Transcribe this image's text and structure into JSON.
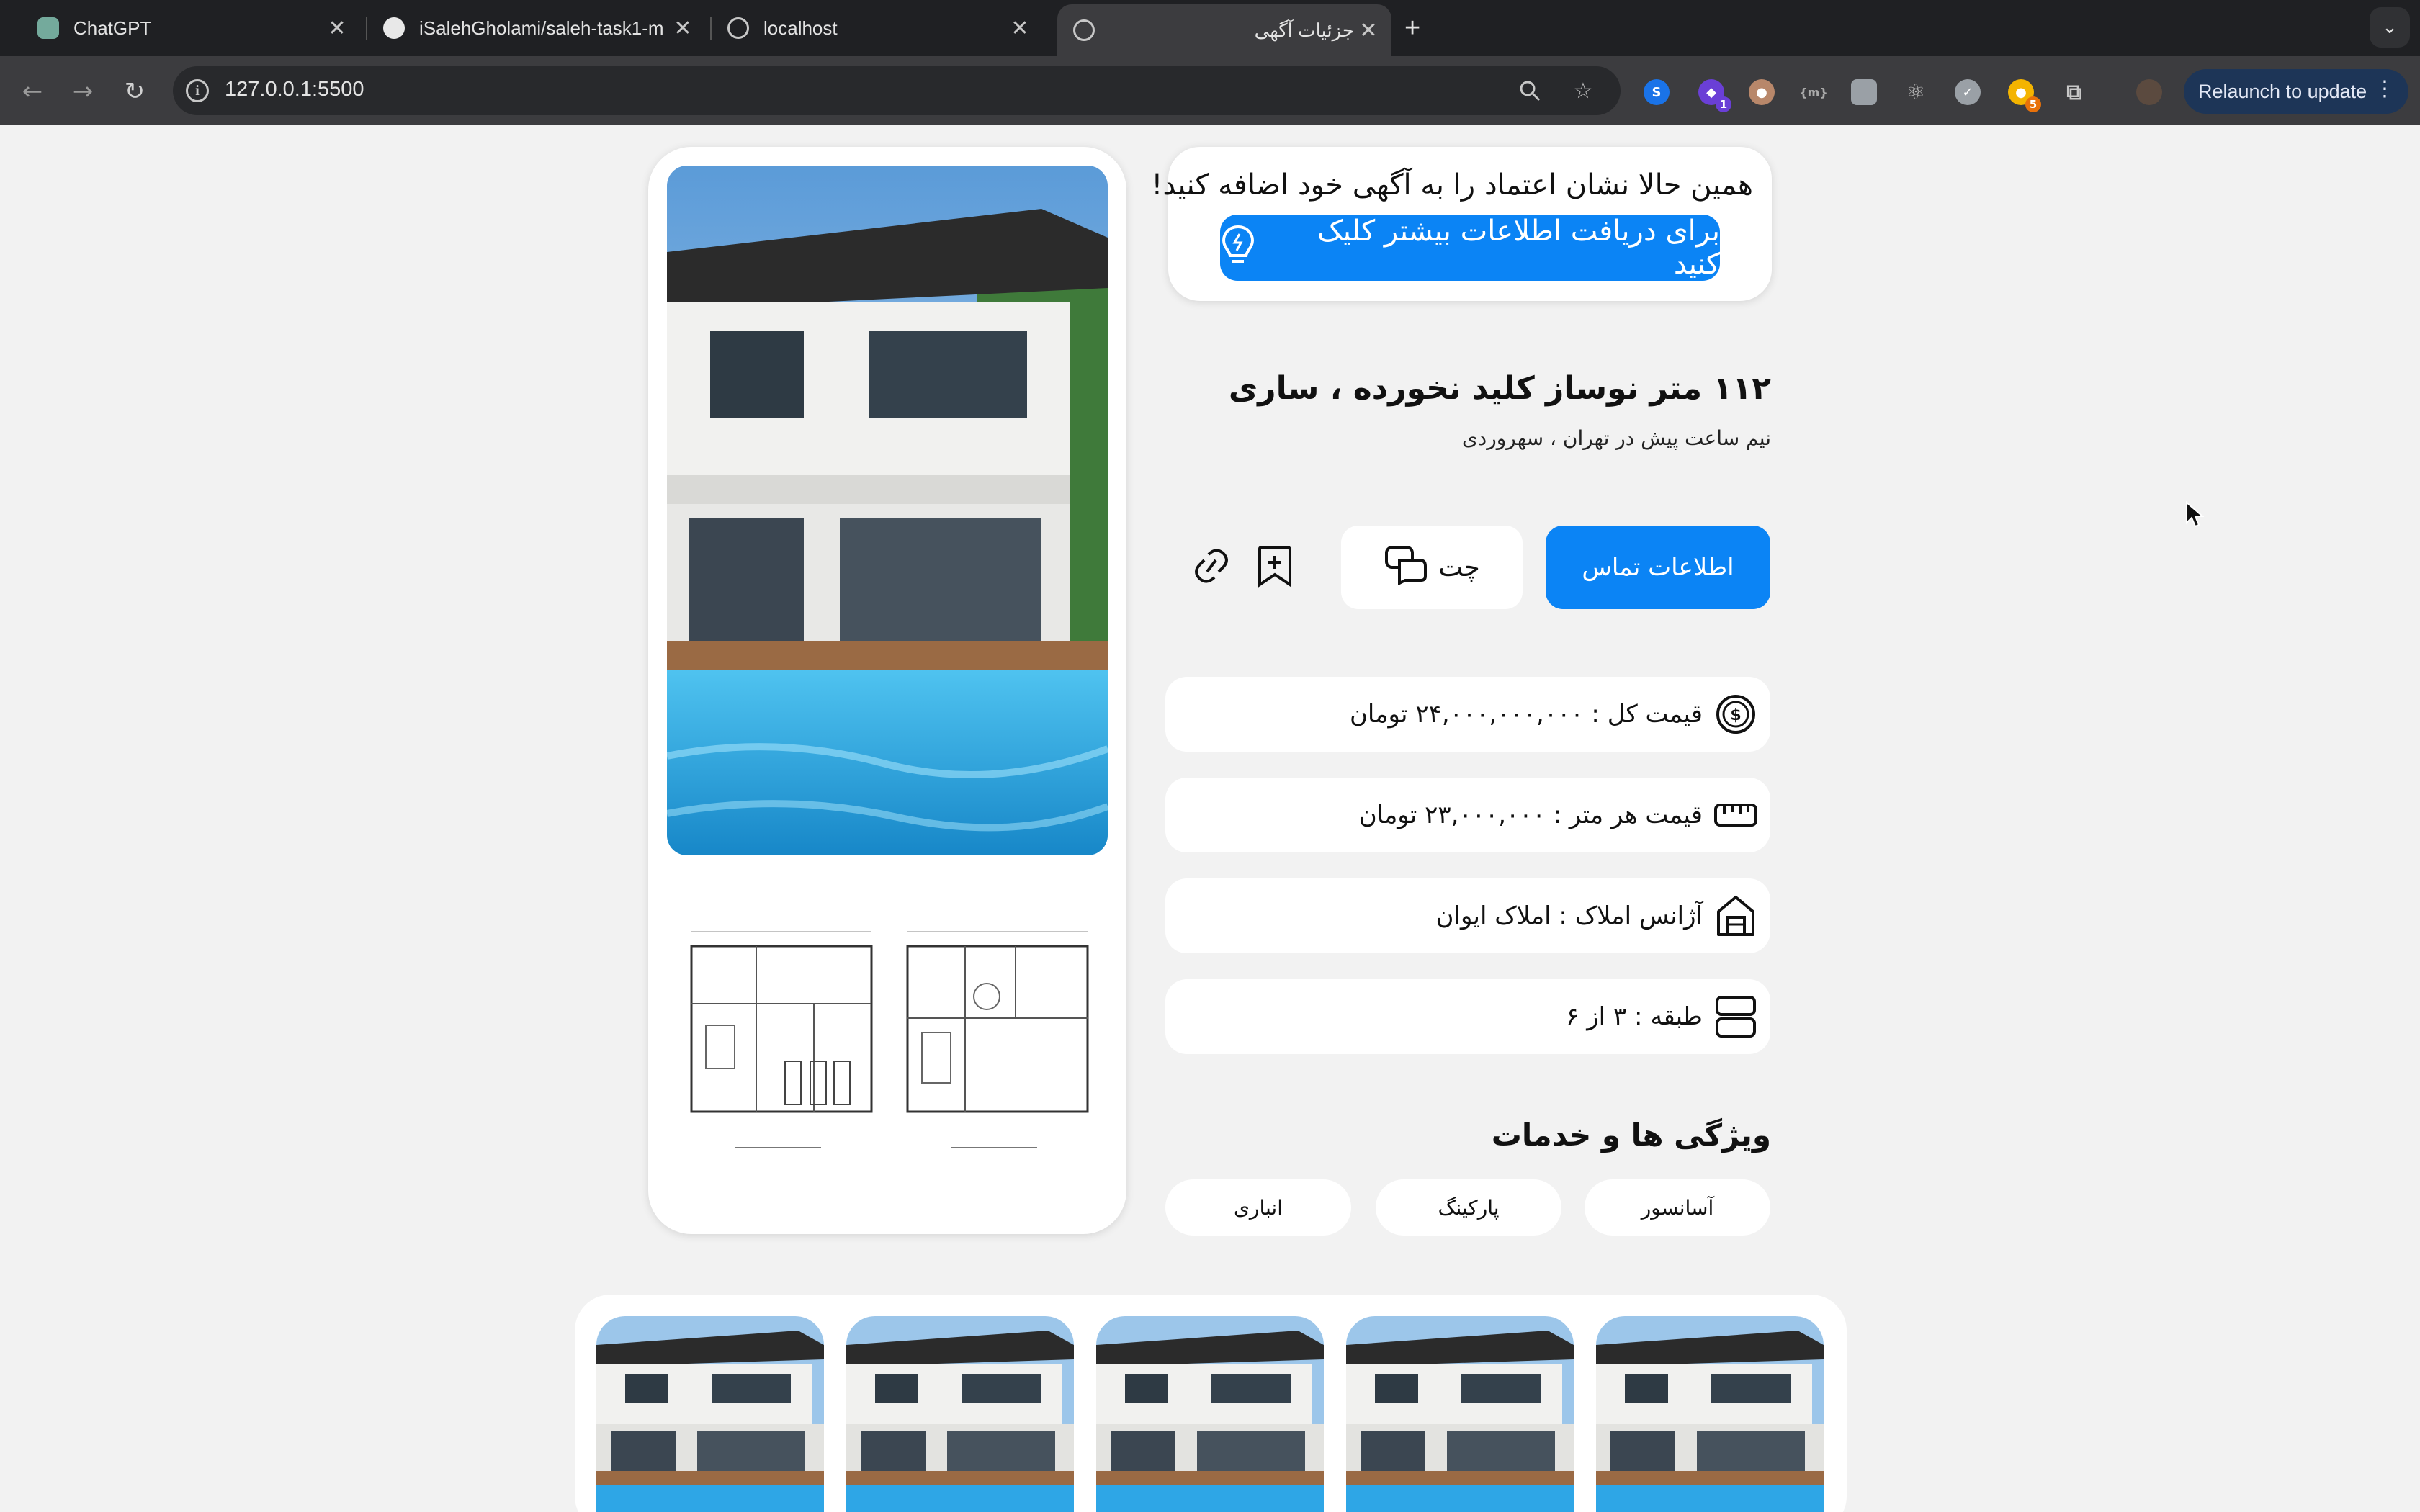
{
  "browser": {
    "tabs": [
      {
        "title": "ChatGPT",
        "icon": "chatgpt-icon",
        "active": false
      },
      {
        "title": "iSalehGholami/saleh-task1-m",
        "icon": "github-icon",
        "active": false
      },
      {
        "title": "localhost",
        "icon": "globe-icon",
        "active": false
      },
      {
        "title": "جزئیات آگهی",
        "icon": "globe-icon",
        "active": true
      }
    ],
    "new_tab": "+",
    "url": "127.0.0.1:5500",
    "extension_badges": {
      "first": "1",
      "second": "5"
    },
    "relaunch_label": "Relaunch to update"
  },
  "promo": {
    "title": "همین حالا نشان اعتماد را به آگهی خود اضافه کنید!",
    "button_label": "برای دریافت اطلاعات بیشتر کلیک کنید"
  },
  "listing": {
    "title": "۱۱۲ متر نوساز کلید نخورده ، ساری",
    "subtitle": "نیم ساعت پیش در تهران ، سهروردی",
    "contact_label": "اطلاعات تماس",
    "chat_label": "چت"
  },
  "details": {
    "total_price": "قیمت کل : ۲۴,۰۰۰,۰۰۰,۰۰۰ تومان",
    "price_per_meter": "قیمت هر متر : ۲۳,۰۰۰,۰۰۰ تومان",
    "agency": "آژانس املاک : املاک ایوان",
    "floor": "طبقه : ۳ از ۶"
  },
  "features": {
    "title": "ویژگی ها و خدمات",
    "items": [
      "آسانسور",
      "پارکینگ",
      "انباری"
    ]
  },
  "gallery": {
    "count": 5
  },
  "colors": {
    "accent": "#0b84f5",
    "page_bg": "#f2f2f2",
    "chrome_dark": "#1f2023"
  }
}
